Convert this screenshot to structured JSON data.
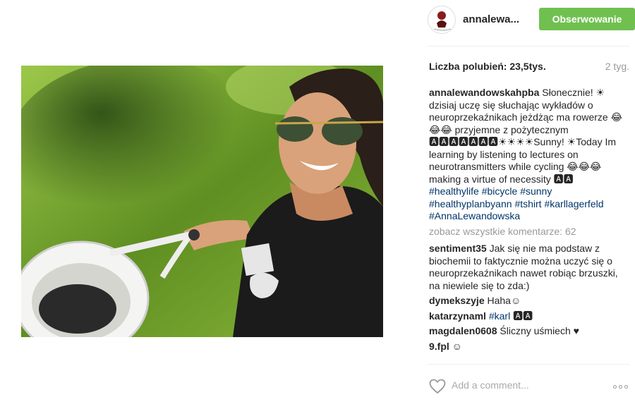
{
  "post": {
    "username": "annalewa...",
    "follow_label": "Obserwowanie",
    "likes": "Liczba polubień: 23,5tys.",
    "time": "2 tyg.",
    "caption": {
      "user": "annalewandowskahpba",
      "text": "Słonecznie! ☀dzisiaj uczę się słuchając wykładów o neuroprzekaźnikach jeżdżąc ma rowerze 😂😂😂 przyjemne z pożytecznym 🅰🅰🅰🅰🅰🅰🅰☀☀☀☀Sunny! ☀Today Im learning by listening to lectures on neurotransmitters while cycling 😂😂😂 making a virtue of necessity 🅰🅰",
      "tags": [
        "#healthylife",
        "#bicycle",
        "#sunny",
        "#healthyplanbyann",
        "#tshirt",
        "#karllagerfeld",
        "#AnnaLewandowska"
      ]
    },
    "view_all_comments": "zobacz wszystkie komentarze: 62",
    "comments": [
      {
        "user": "sentiment35",
        "text": "Jak się nie ma podstaw z biochemii to faktycznie można uczyć się o neuroprzekaźnikach nawet robiąc brzuszki, na niewiele się to zda:)"
      },
      {
        "user": "dymekszyje",
        "text": "Haha☺"
      },
      {
        "user": "katarzynaml",
        "tag": "#karl",
        "text": "🅰🅰"
      },
      {
        "user": "magdalen0608",
        "text": "Śliczny uśmiech ♥"
      },
      {
        "user": "9.fpl",
        "text": "☺"
      }
    ],
    "add_comment_placeholder": "Add a comment..."
  },
  "icons": {
    "avatar": "avatar-logo",
    "like": "heart-icon",
    "more": "more-options-icon"
  },
  "colors": {
    "follow_button": "#70c050",
    "hashtag": "#003569",
    "muted": "#999999"
  }
}
